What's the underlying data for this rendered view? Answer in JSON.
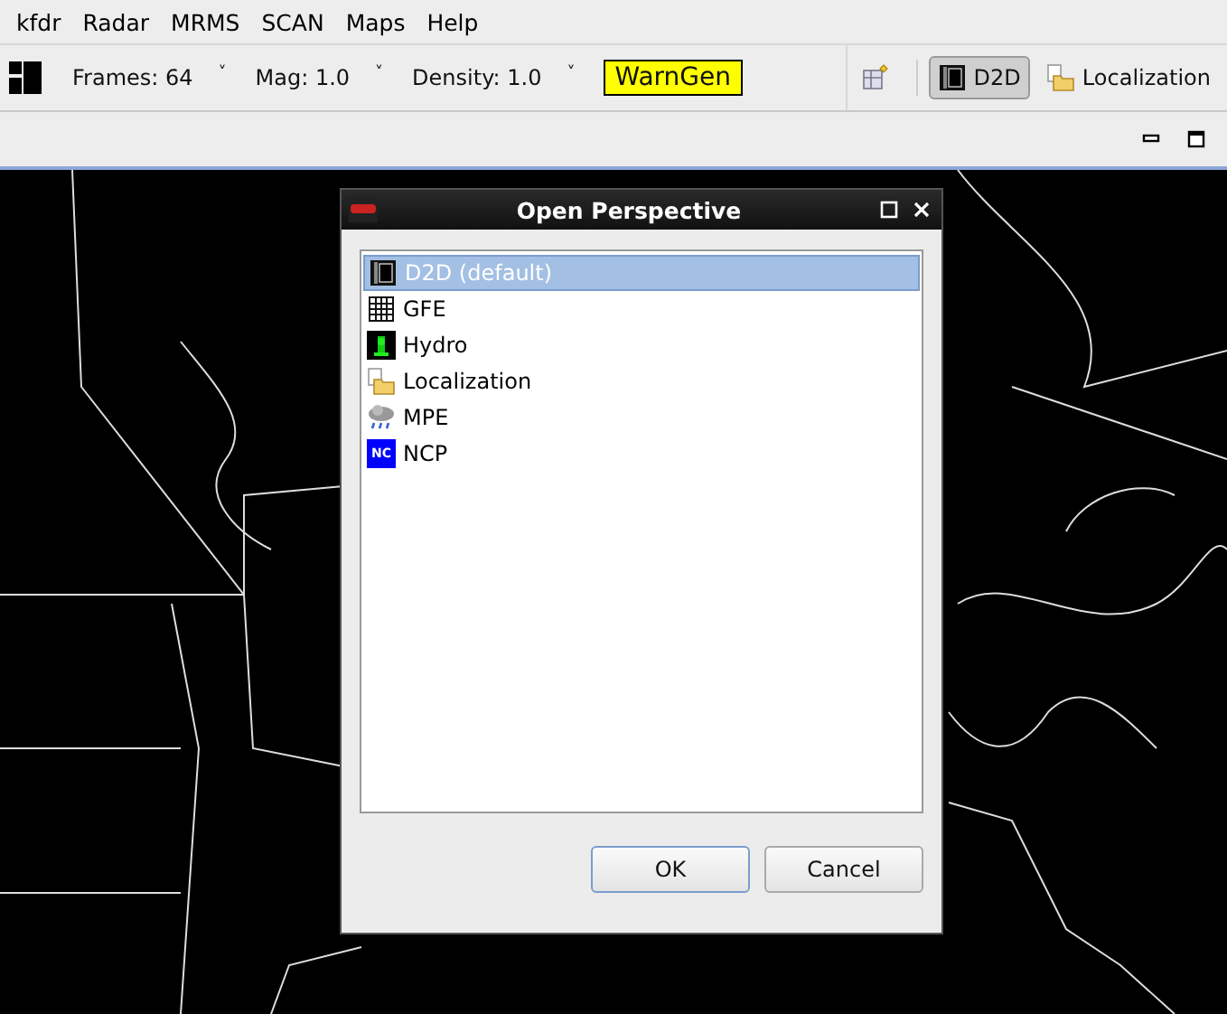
{
  "menu_bar": [
    "kfdr",
    "Radar",
    "MRMS",
    "SCAN",
    "Maps",
    "Help"
  ],
  "toolbar": {
    "controls": [
      {
        "label": "Frames: 64",
        "caret": "˅"
      },
      {
        "label": "Mag: 1.0",
        "caret": "˅"
      },
      {
        "label": "Density: 1.0",
        "caret": "˅"
      }
    ],
    "warngen": "WarnGen",
    "perspectives": [
      {
        "label": "D2D",
        "kind": "d2d",
        "selected": true
      },
      {
        "label": "Localization",
        "kind": "localization",
        "selected": false
      }
    ]
  },
  "dialog": {
    "title": "Open Perspective",
    "items": [
      {
        "label": "D2D (default)",
        "kind": "d2d",
        "selected": true
      },
      {
        "label": "GFE",
        "kind": "gfe",
        "selected": false
      },
      {
        "label": "Hydro",
        "kind": "hydro",
        "selected": false
      },
      {
        "label": "Localization",
        "kind": "localization",
        "selected": false
      },
      {
        "label": "MPE",
        "kind": "mpe",
        "selected": false
      },
      {
        "label": "NCP",
        "kind": "ncp",
        "selected": false,
        "badge": "NC"
      }
    ],
    "buttons": [
      "OK",
      "Cancel"
    ]
  }
}
